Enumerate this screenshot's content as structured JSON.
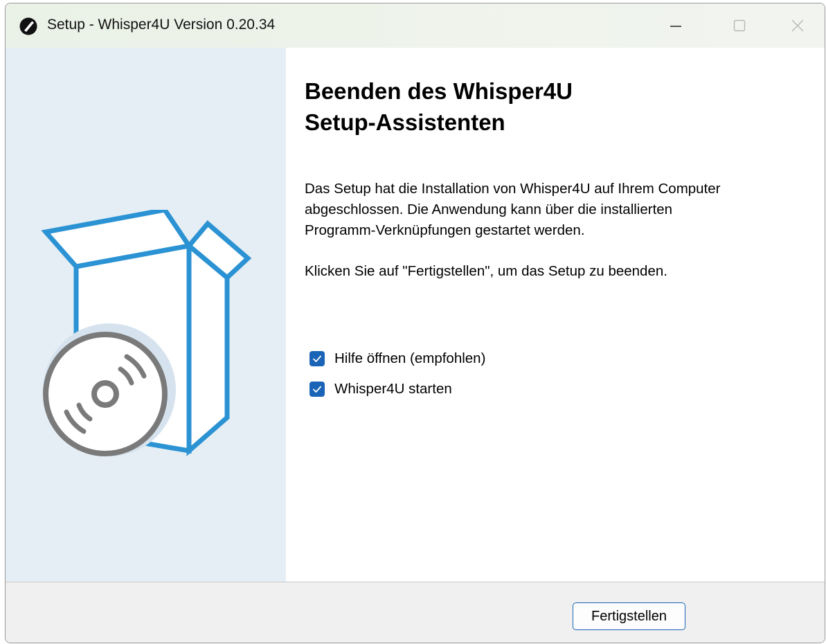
{
  "window": {
    "title": "Setup - Whisper4U Version 0.20.34",
    "icon": "whisper4u-app-icon"
  },
  "titlebar_controls": {
    "minimize_icon": "minimize-icon",
    "maximize_icon": "maximize-icon",
    "close_icon": "close-icon"
  },
  "sidebar": {
    "illustration": "software-box-with-disc"
  },
  "main": {
    "heading_line1": "Beenden des Whisper4U",
    "heading_line2": "Setup-Assistenten",
    "paragraph_lines": [
      "Das Setup hat die Installation von Whisper4U auf Ihrem Computer",
      "abgeschlossen. Die Anwendung kann über die installierten",
      "Programm-Verknüpfungen gestartet werden."
    ],
    "instruction": "Klicken Sie auf \"Fertigstellen\", um das Setup zu beenden.",
    "options": [
      {
        "label": "Hilfe öffnen (empfohlen)",
        "checked": true
      },
      {
        "label": "Whisper4U starten",
        "checked": true
      }
    ]
  },
  "footer": {
    "finish_label": "Fertigstellen"
  },
  "colors": {
    "accent": "#1a63b6",
    "box_blue": "#2b93d3",
    "disc_gray": "#7a7a7a",
    "sidebar_bg": "#e6eef5"
  }
}
